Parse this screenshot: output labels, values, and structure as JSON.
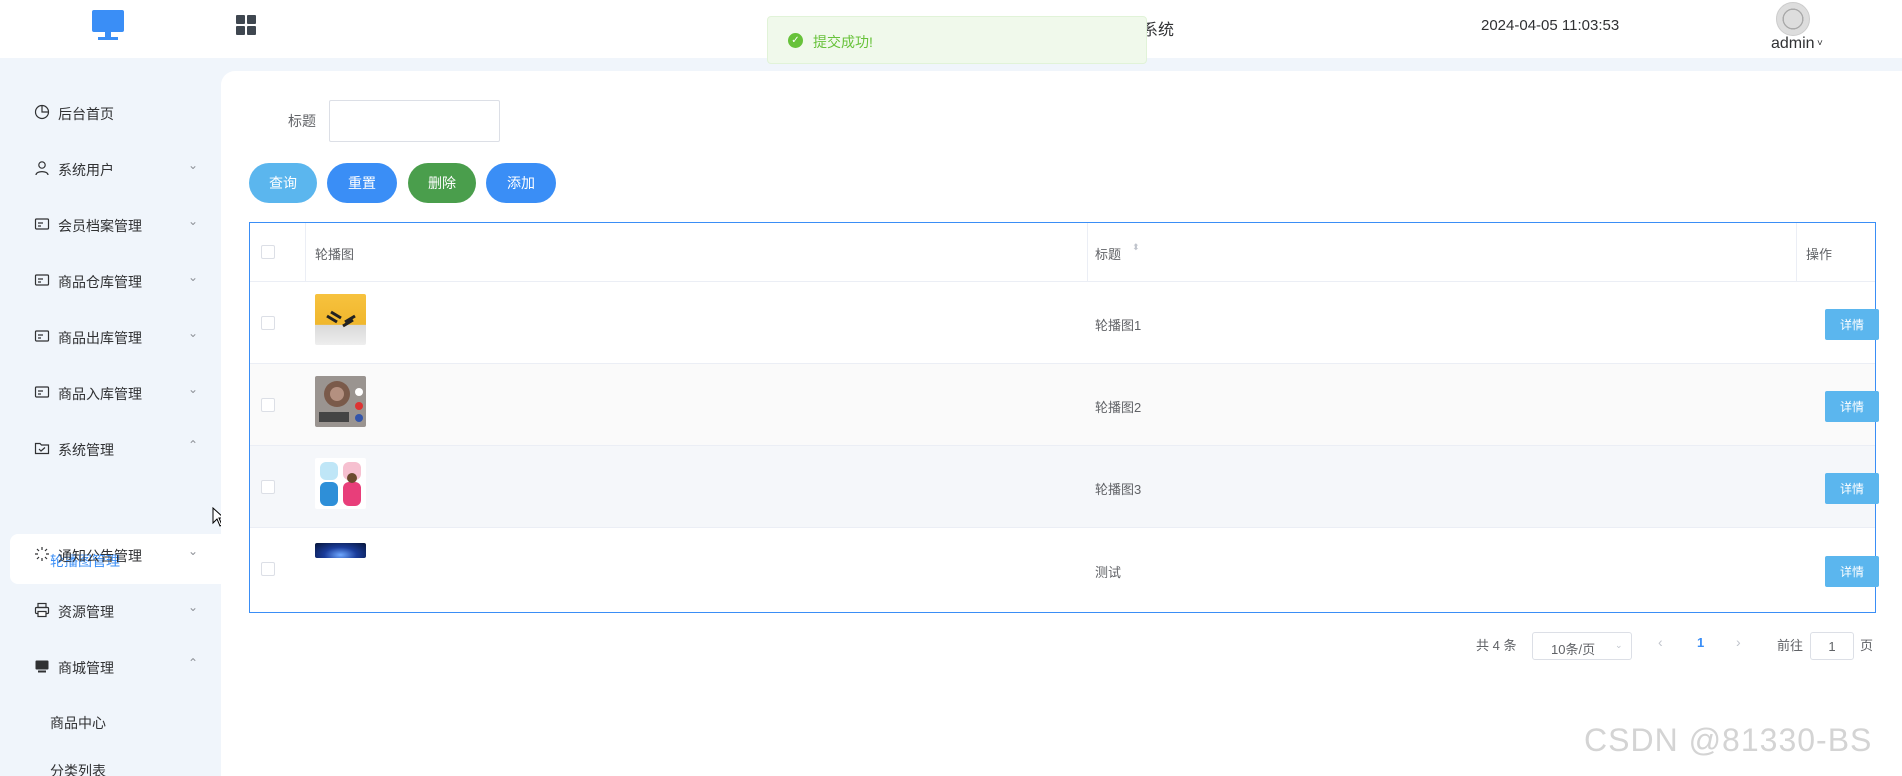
{
  "header": {
    "title_fragment": "系统",
    "datetime": "2024-04-05 11:03:53",
    "username": "admin",
    "caret": "˅"
  },
  "toast": {
    "message": "提交成功!",
    "icon": "✓"
  },
  "sidebar": {
    "items": [
      {
        "label": "后台首页",
        "icon": "dashboard-icon",
        "arrow": ""
      },
      {
        "label": "系统用户",
        "icon": "user-icon",
        "arrow": "⌄"
      },
      {
        "label": "会员档案管理",
        "icon": "card-icon",
        "arrow": "⌄"
      },
      {
        "label": "商品仓库管理",
        "icon": "card-icon",
        "arrow": "⌄"
      },
      {
        "label": "商品出库管理",
        "icon": "card-icon",
        "arrow": "⌄"
      },
      {
        "label": "商品入库管理",
        "icon": "card-icon",
        "arrow": "⌄"
      },
      {
        "label": "系统管理",
        "icon": "folder-icon",
        "arrow": "⌃"
      },
      {
        "label": "通知公告管理",
        "icon": "loading-icon",
        "arrow": "⌄"
      },
      {
        "label": "资源管理",
        "icon": "printer-icon",
        "arrow": "⌄"
      },
      {
        "label": "商城管理",
        "icon": "monitor-icon",
        "arrow": "⌃"
      }
    ],
    "active_sub": "轮播图管理",
    "sub_items": [
      "商品中心",
      "分类列表"
    ]
  },
  "search": {
    "label": "标题",
    "value": ""
  },
  "buttons": {
    "query": "查询",
    "reset": "重置",
    "delete": "删除",
    "add": "添加"
  },
  "table": {
    "headers": {
      "image": "轮播图",
      "title": "标题",
      "actions": "操作"
    },
    "sort_icon": "⬍",
    "rows": [
      {
        "title": "轮播图1",
        "action": "详情"
      },
      {
        "title": "轮播图2",
        "action": "详情"
      },
      {
        "title": "轮播图3",
        "action": "详情"
      },
      {
        "title": "测试",
        "action": "详情"
      }
    ]
  },
  "pagination": {
    "total": "共 4 条",
    "page_size": "10条/页",
    "current": "1",
    "goto_prefix": "前往",
    "goto_value": "1",
    "goto_suffix": "页",
    "prev": "‹",
    "next": "›",
    "size_arrow": "⌄"
  },
  "watermark": "CSDN @81330-BS",
  "colors": {
    "accent": "#3a8ef6",
    "success": "#67c23a",
    "info_button": "#5bb6ee",
    "danger_button": "#4a9e4c"
  }
}
